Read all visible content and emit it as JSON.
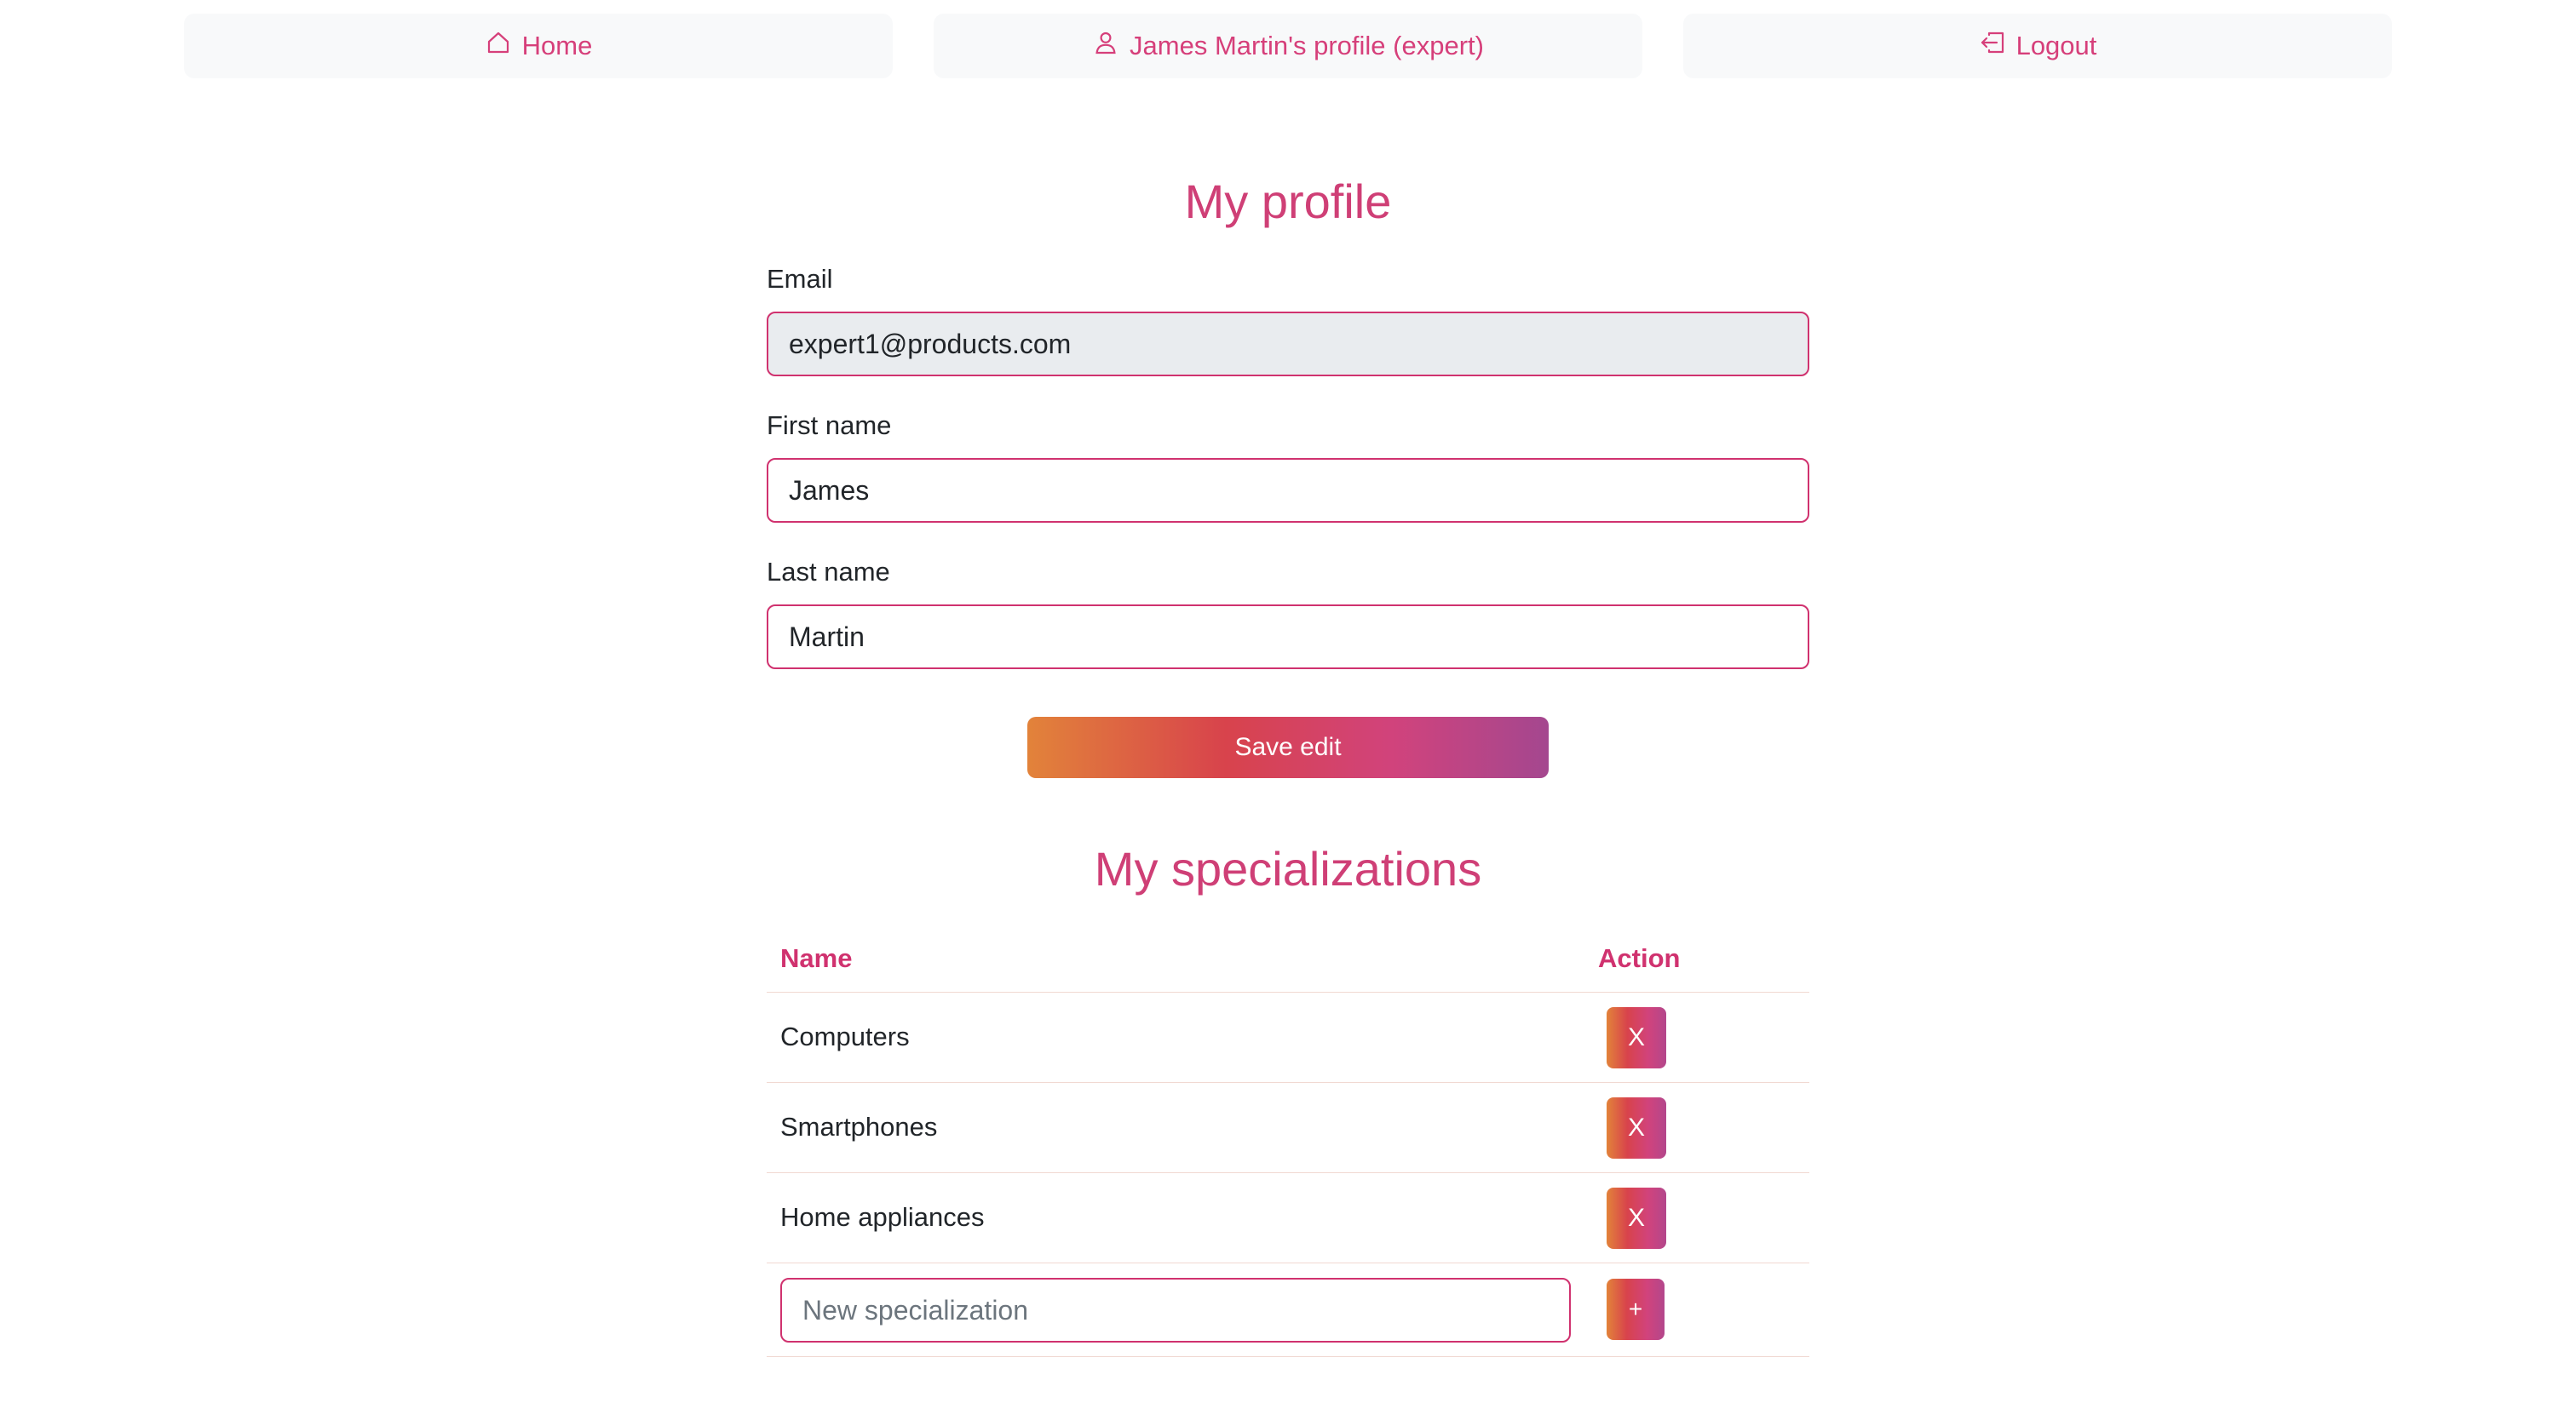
{
  "nav": {
    "home": {
      "label": "Home",
      "icon": "house-icon"
    },
    "profile": {
      "label": "James Martin's profile (expert)",
      "icon": "person-icon"
    },
    "logout": {
      "label": "Logout",
      "icon": "logout-icon"
    }
  },
  "profile_section": {
    "title": "My profile",
    "email": {
      "label": "Email",
      "value": "expert1@products.com"
    },
    "first_name": {
      "label": "First name",
      "value": "James"
    },
    "last_name": {
      "label": "Last name",
      "value": "Martin"
    },
    "save_label": "Save edit"
  },
  "specializations_section": {
    "title": "My specializations",
    "columns": {
      "name": "Name",
      "action": "Action"
    },
    "rows": [
      {
        "name": "Computers",
        "action_label": "X"
      },
      {
        "name": "Smartphones",
        "action_label": "X"
      },
      {
        "name": "Home appliances",
        "action_label": "X"
      }
    ],
    "new_placeholder": "New specialization",
    "add_label": "+"
  },
  "colors": {
    "accent": "#d0326f",
    "gradient_start": "#e2833a",
    "gradient_end": "#a4478f",
    "nav_bg": "#f8f9fa"
  }
}
